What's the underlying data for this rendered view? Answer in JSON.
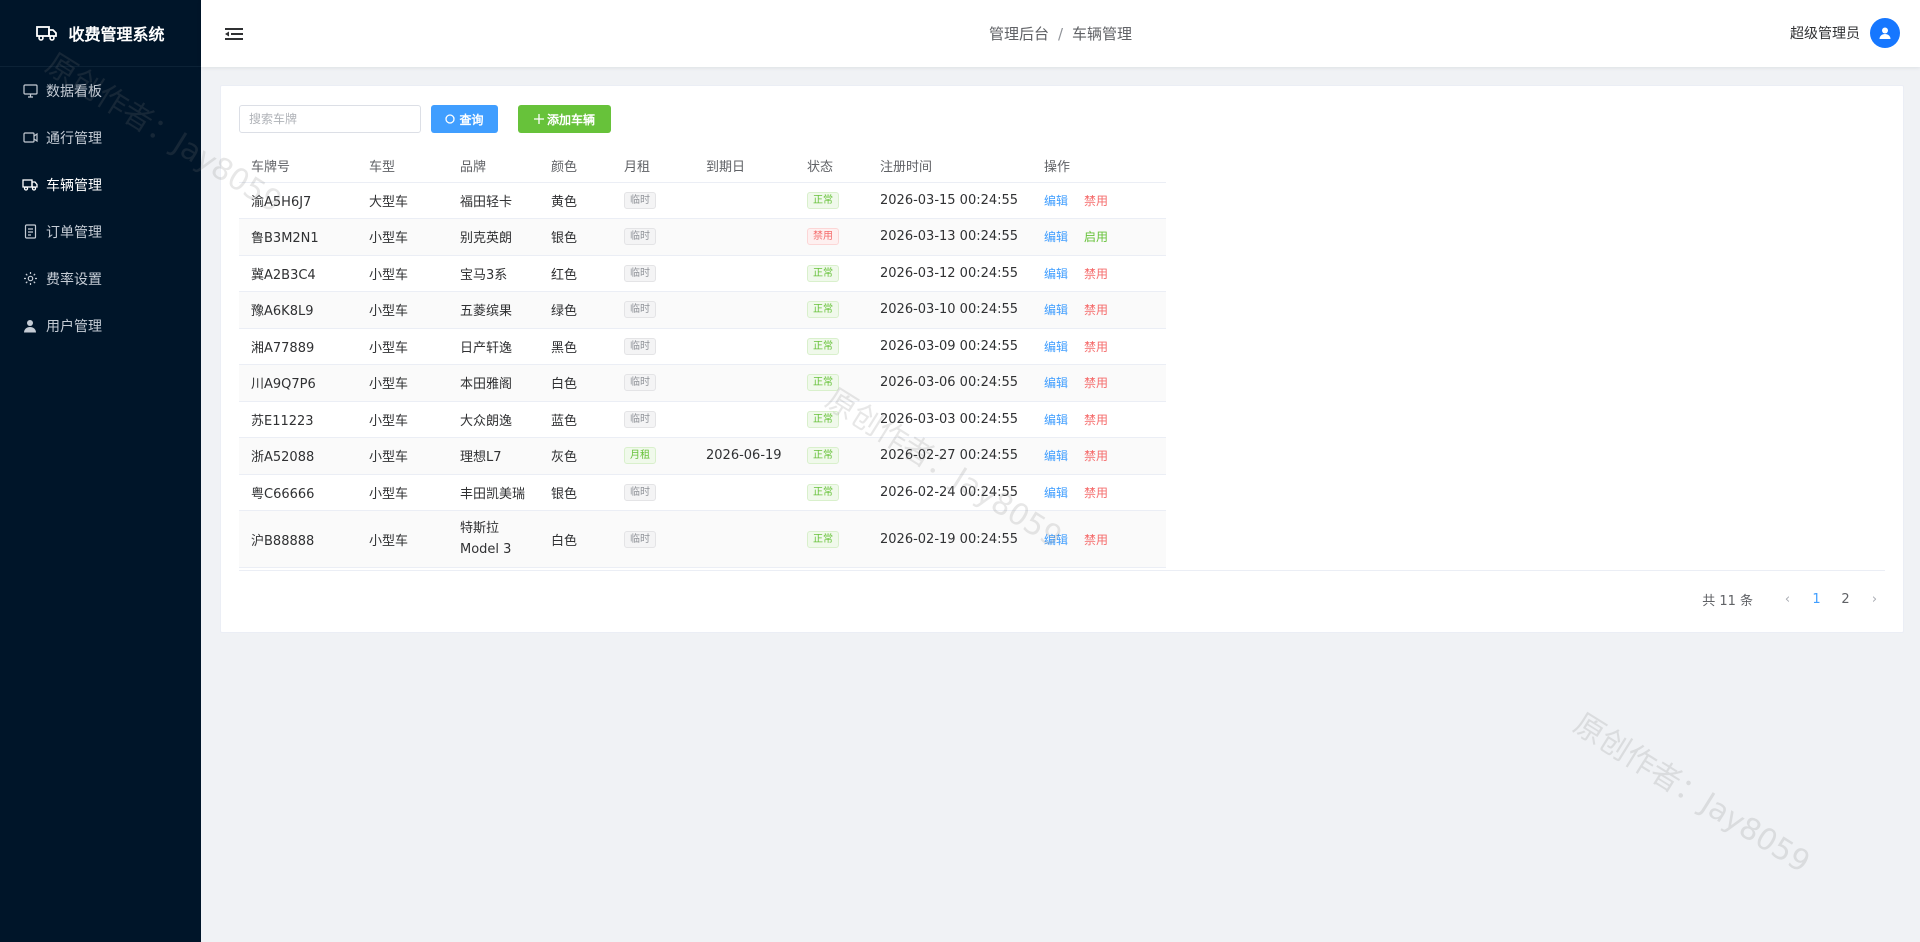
{
  "app": {
    "title": "收费管理系统"
  },
  "sidebar": {
    "items": [
      {
        "label": "数据看板",
        "icon": "monitor-icon"
      },
      {
        "label": "通行管理",
        "icon": "camera-icon"
      },
      {
        "label": "车辆管理",
        "icon": "truck-icon",
        "active": true
      },
      {
        "label": "订单管理",
        "icon": "document-icon"
      },
      {
        "label": "费率设置",
        "icon": "gear-icon"
      },
      {
        "label": "用户管理",
        "icon": "user-icon"
      }
    ]
  },
  "header": {
    "breadcrumb": [
      "管理后台",
      "车辆管理"
    ],
    "separator": "/",
    "user_name": "超级管理员"
  },
  "toolbar": {
    "search_placeholder": "搜索车牌",
    "query_label": "查询",
    "add_label": "添加车辆"
  },
  "table": {
    "columns": [
      "车牌号",
      "车型",
      "品牌",
      "颜色",
      "月租",
      "到期日",
      "状态",
      "注册时间",
      "操作"
    ],
    "rows": [
      {
        "plate": "渝A5H6J7",
        "type": "大型车",
        "brand": "福田轻卡",
        "color": "黄色",
        "rent": "临时",
        "rent_kind": "info",
        "expiry": "",
        "status": "正常",
        "status_kind": "success",
        "registered": "2026-03-15 00:24:55",
        "edit": "编辑",
        "toggle": "禁用",
        "toggle_kind": "disable"
      },
      {
        "plate": "鲁B3M2N1",
        "type": "小型车",
        "brand": "别克英朗",
        "color": "银色",
        "rent": "临时",
        "rent_kind": "info",
        "expiry": "",
        "status": "禁用",
        "status_kind": "danger",
        "registered": "2026-03-13 00:24:55",
        "edit": "编辑",
        "toggle": "启用",
        "toggle_kind": "enable"
      },
      {
        "plate": "冀A2B3C4",
        "type": "小型车",
        "brand": "宝马3系",
        "color": "红色",
        "rent": "临时",
        "rent_kind": "info",
        "expiry": "",
        "status": "正常",
        "status_kind": "success",
        "registered": "2026-03-12 00:24:55",
        "edit": "编辑",
        "toggle": "禁用",
        "toggle_kind": "disable"
      },
      {
        "plate": "豫A6K8L9",
        "type": "小型车",
        "brand": "五菱缤果",
        "color": "绿色",
        "rent": "临时",
        "rent_kind": "info",
        "expiry": "",
        "status": "正常",
        "status_kind": "success",
        "registered": "2026-03-10 00:24:55",
        "edit": "编辑",
        "toggle": "禁用",
        "toggle_kind": "disable"
      },
      {
        "plate": "湘A77889",
        "type": "小型车",
        "brand": "日产轩逸",
        "color": "黑色",
        "rent": "临时",
        "rent_kind": "info",
        "expiry": "",
        "status": "正常",
        "status_kind": "success",
        "registered": "2026-03-09 00:24:55",
        "edit": "编辑",
        "toggle": "禁用",
        "toggle_kind": "disable"
      },
      {
        "plate": "川A9Q7P6",
        "type": "小型车",
        "brand": "本田雅阁",
        "color": "白色",
        "rent": "临时",
        "rent_kind": "info",
        "expiry": "",
        "status": "正常",
        "status_kind": "success",
        "registered": "2026-03-06 00:24:55",
        "edit": "编辑",
        "toggle": "禁用",
        "toggle_kind": "disable"
      },
      {
        "plate": "苏E11223",
        "type": "小型车",
        "brand": "大众朗逸",
        "color": "蓝色",
        "rent": "临时",
        "rent_kind": "info",
        "expiry": "",
        "status": "正常",
        "status_kind": "success",
        "registered": "2026-03-03 00:24:55",
        "edit": "编辑",
        "toggle": "禁用",
        "toggle_kind": "disable"
      },
      {
        "plate": "浙A52088",
        "type": "小型车",
        "brand": "理想L7",
        "color": "灰色",
        "rent": "月租",
        "rent_kind": "success",
        "expiry": "2026-06-19",
        "status": "正常",
        "status_kind": "success",
        "registered": "2026-02-27 00:24:55",
        "edit": "编辑",
        "toggle": "禁用",
        "toggle_kind": "disable"
      },
      {
        "plate": "粤C66666",
        "type": "小型车",
        "brand": "丰田凯美瑞",
        "color": "银色",
        "rent": "临时",
        "rent_kind": "info",
        "expiry": "",
        "status": "正常",
        "status_kind": "success",
        "registered": "2026-02-24 00:24:55",
        "edit": "编辑",
        "toggle": "禁用",
        "toggle_kind": "disable"
      },
      {
        "plate": "沪B88888",
        "type": "小型车",
        "brand": "特斯拉 Model 3",
        "color": "白色",
        "rent": "临时",
        "rent_kind": "info",
        "expiry": "",
        "status": "正常",
        "status_kind": "success",
        "registered": "2026-02-19 00:24:55",
        "edit": "编辑",
        "toggle": "禁用",
        "toggle_kind": "disable"
      }
    ]
  },
  "pagination": {
    "total_label": "共 11 条",
    "pages": [
      "1",
      "2"
    ],
    "current": "1",
    "prev_icon": "‹",
    "next_icon": "›"
  },
  "watermark": "原创作者：Jay8059",
  "colors": {
    "sidebar_bg": "#001529",
    "primary": "#409eff",
    "success": "#67c23a",
    "danger": "#f56c6c",
    "avatar": "#1677ff"
  }
}
